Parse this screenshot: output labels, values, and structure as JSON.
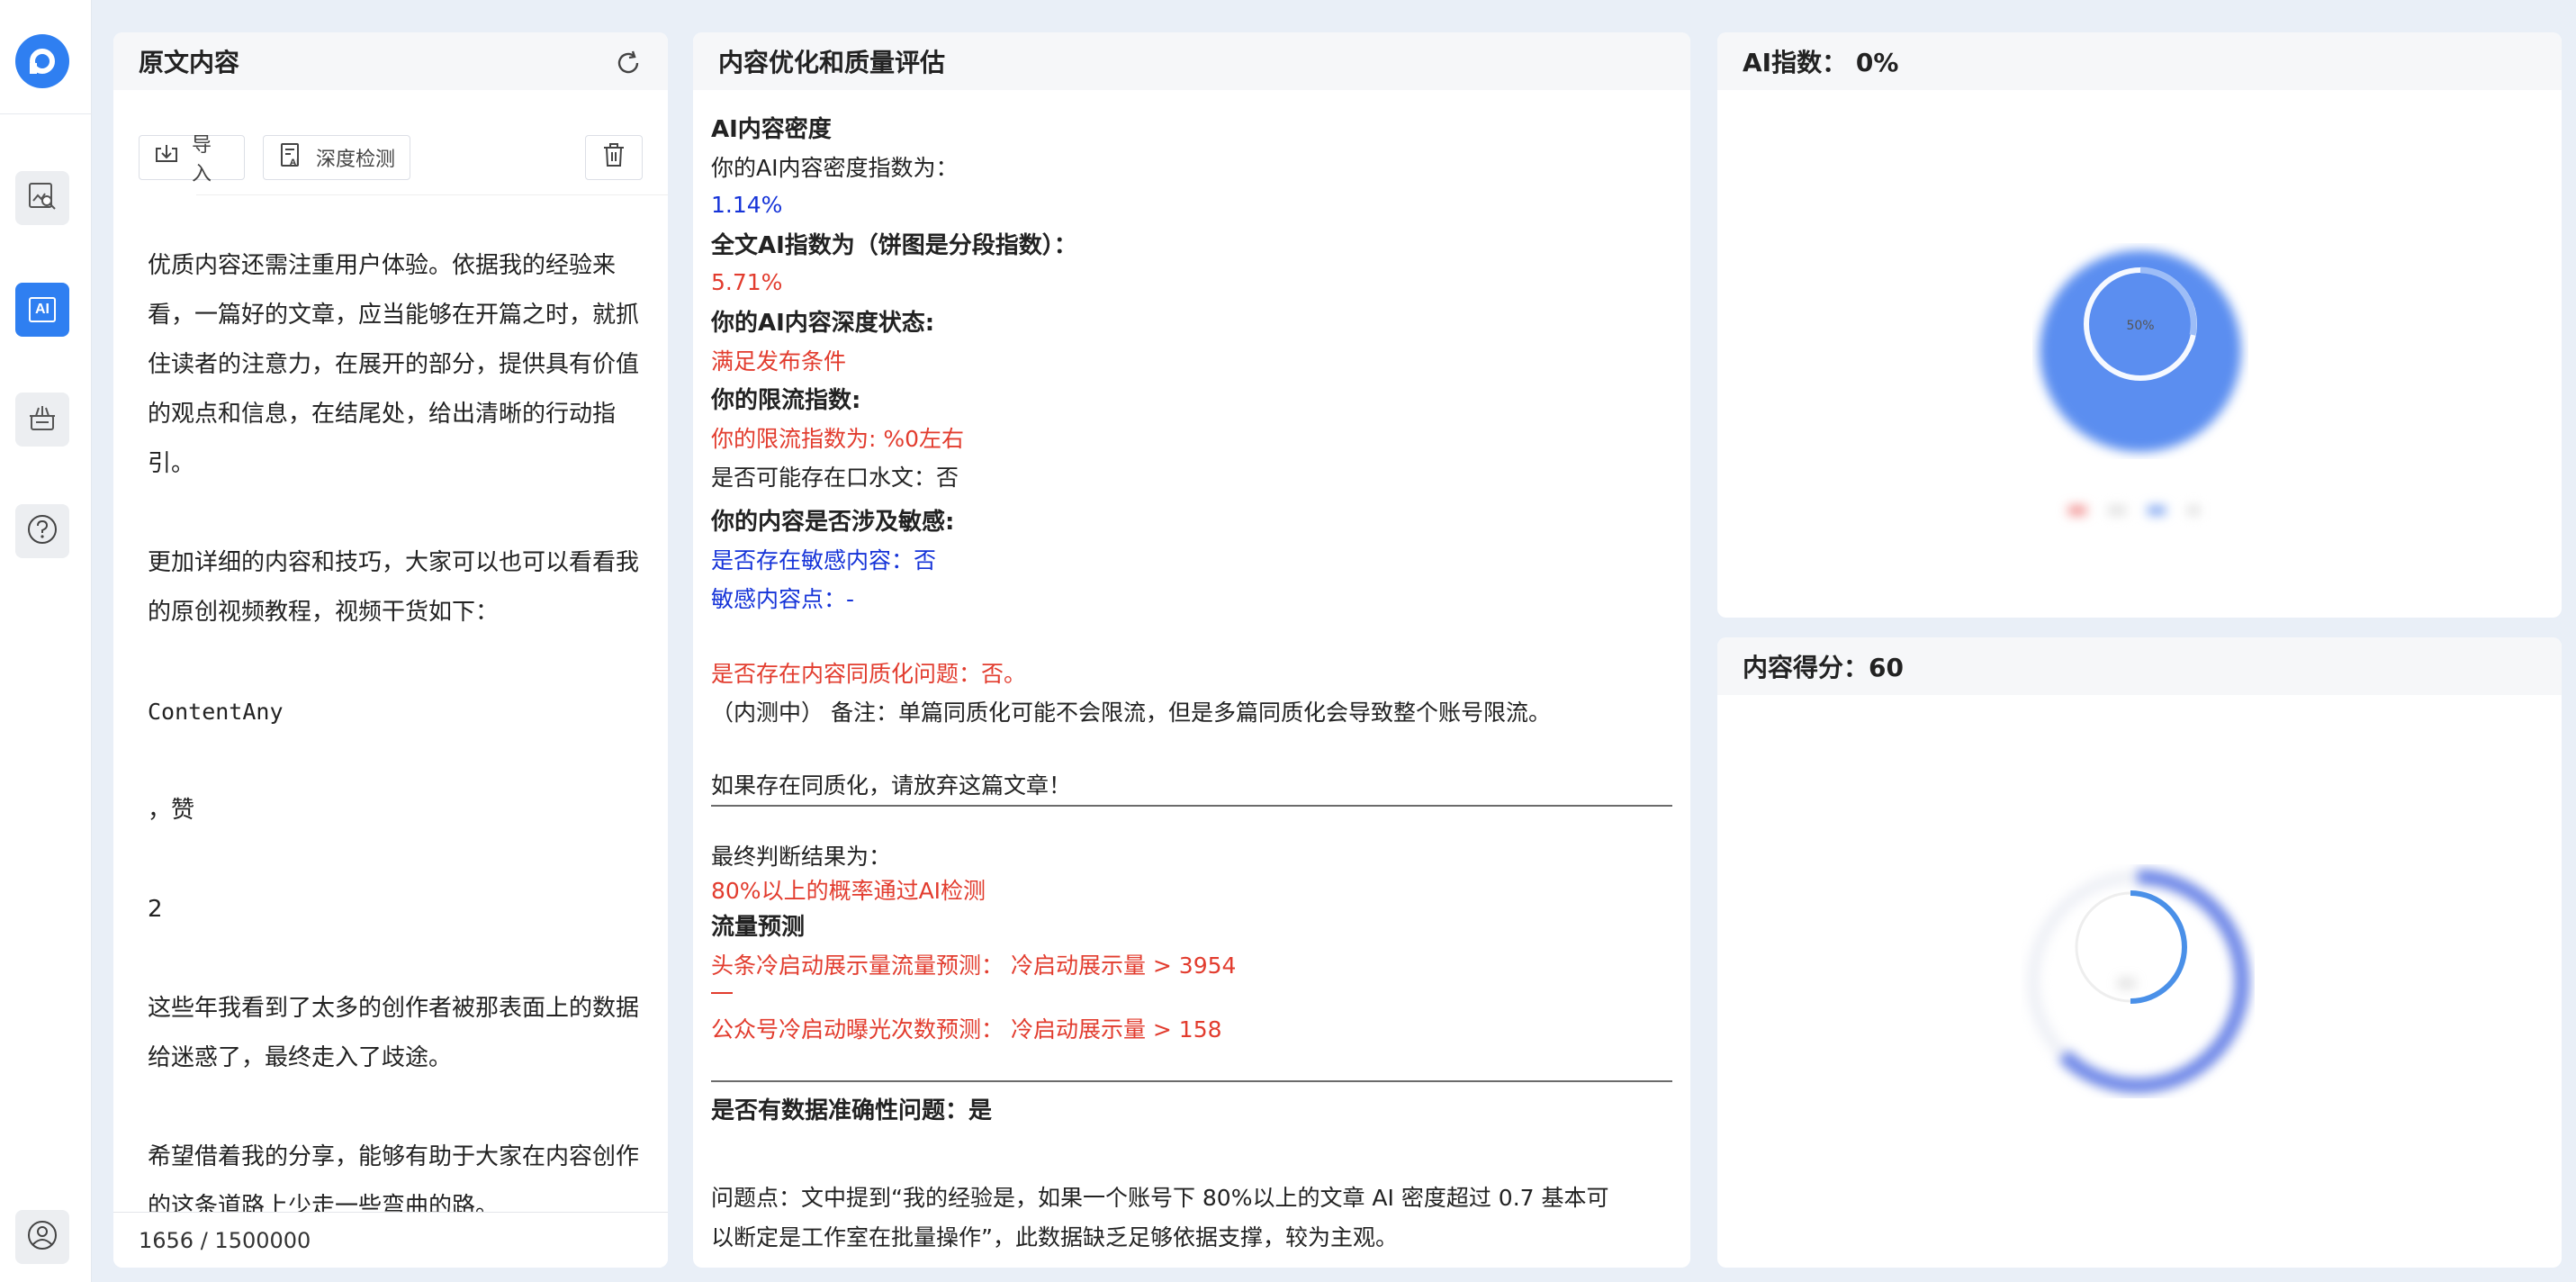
{
  "sidebar": {
    "logo_icon": "app-logo-icon",
    "items": [
      {
        "name": "image-search-icon",
        "active": false
      },
      {
        "name": "ai-icon",
        "label": "AI",
        "active": true
      },
      {
        "name": "toolbox-icon",
        "active": false
      },
      {
        "name": "help-icon",
        "active": false
      }
    ],
    "bottom": {
      "name": "user-icon"
    }
  },
  "left_panel": {
    "title": "原文内容",
    "import_label": "导入",
    "deep_check_label": "深度检测",
    "paragraphs": [
      "优质内容还需注重用户体验。依据我的经验来看，一篇好的文章，应当能够在开篇之时，就抓住读者的注意力，在展开的部分，提供具有价值的观点和信息，在结尾处，给出清晰的行动指引。",
      "更加详细的内容和技巧，大家可以也可以看看我的原创视频教程，视频干货如下：",
      "ContentAny",
      "，赞",
      "2",
      "这些年我看到了太多的创作者被那表面上的数据给迷惑了，最终走入了歧途。",
      "希望借着我的分享，能够有助于大家在内容创作的这条道路上少走一些弯曲的路。"
    ],
    "char_count": "1656 / 1500000"
  },
  "mid_panel": {
    "title": "内容优化和质量评估",
    "ai_density_heading": "AI内容密度",
    "ai_density_label": "你的AI内容密度指数为：",
    "ai_density_value": "1.14%",
    "full_ai_label": "全文AI指数为（饼图是分段指数）：",
    "full_ai_value": "5.71%",
    "depth_label": "你的AI内容深度状态:",
    "depth_value": "满足发布条件",
    "limit_label": "你的限流指数:",
    "limit_value": "你的限流指数为: %0左右",
    "spoken_line": "是否可能存在口水文：否",
    "sensitive_label": "你的内容是否涉及敏感:",
    "sensitive_exist": "是否存在敏感内容：否",
    "sensitive_points": "敏感内容点：-",
    "homog_question": "是否存在内容同质化问题：否。",
    "homog_note": "（内测中） 备注：单篇同质化可能不会限流，但是多篇同质化会导致整个账号限流。",
    "homog_warn": "如果存在同质化，请放弃这篇文章！",
    "final_label": "最终判断结果为：",
    "final_value": "80%以上的概率通过AI检测",
    "traffic_heading": "流量预测",
    "toutiao_pred": "头条冷启动展示量流量预测：  冷启动展示量 > 3954",
    "wechat_pred": "公众号冷启动曝光次数预测：  冷启动展示量 > 158",
    "accuracy_heading": "是否有数据准确性问题：是",
    "issue_text_1": "问题点：文中提到“我的经验是，如果一个账号下 80%以上的文章 AI 密度超过 0.7 基本可",
    "issue_text_2": "以断定是工作室在批量操作”，此数据缺乏足够依据支撑，较为主观。"
  },
  "ai_panel": {
    "title": "AI指数：  0%",
    "pie_center_label": "50%",
    "colors": {
      "outer": "#5b8ef0",
      "inner_ring": "#9dbdf7",
      "legend_red": "#f08a8a",
      "legend_blue": "#7aa2f0"
    }
  },
  "score_panel": {
    "title": "内容得分：60",
    "gauge_label": "60",
    "colors": {
      "ring": "#6c86e8",
      "inner_arc": "#4a90e8"
    }
  }
}
